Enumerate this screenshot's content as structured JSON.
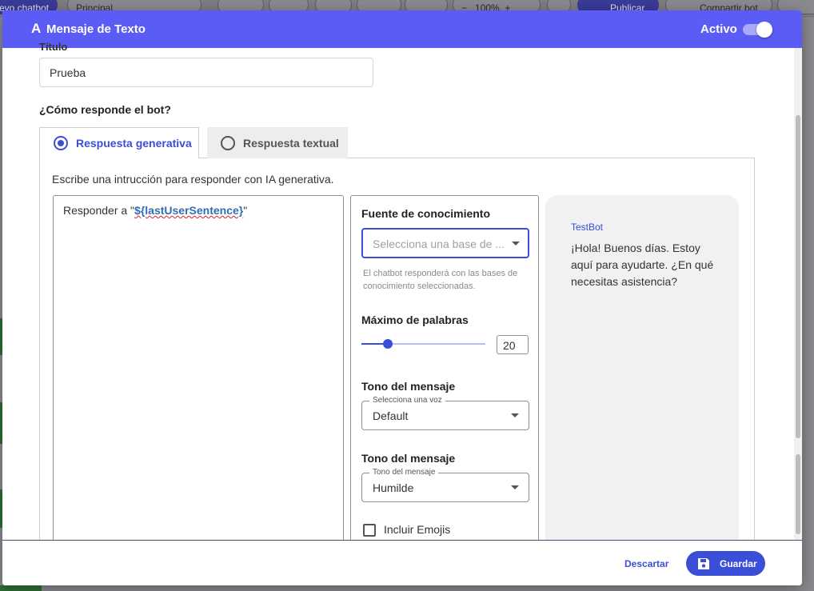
{
  "background_toolbar": {
    "chatbot_tab": "evo chatbot",
    "flow_select": "Principal",
    "zoom": "100%",
    "zoom_minus": "−",
    "zoom_plus": "+",
    "publish_label": "Publicar",
    "share_label": "Compartir bot"
  },
  "modal": {
    "logo_glyph": "A",
    "title": "Mensaje de Texto",
    "active_label": "Activo",
    "active_on": true
  },
  "form": {
    "title_label": "Título",
    "title_value": "Prueba",
    "question": "¿Cómo responde el bot?",
    "tabs": [
      {
        "label": "Respuesta generativa",
        "selected": true
      },
      {
        "label": "Respuesta textual",
        "selected": false
      }
    ],
    "instruction": "Escribe una intrucción para responder con IA generativa.",
    "prompt_prefix": "Responder a \"",
    "prompt_variable": "${lastUserSentence}",
    "prompt_suffix": "\""
  },
  "settings": {
    "knowledge_label": "Fuente de conocimiento",
    "knowledge_placeholder": "Selecciona una base de ...",
    "knowledge_help": "El chatbot responderá con las bases de conocimiento seleccionadas.",
    "max_words_label": "Máximo de palabras",
    "max_words_value": "20",
    "max_words_slider_fraction": 0.21,
    "voice_section_label": "Tono del mensaje",
    "voice_legend": "Selecciona una voz",
    "voice_value": "Default",
    "tone_section_label": "Tono del mensaje",
    "tone_legend": "Tono del mensaje",
    "tone_value": "Humilde",
    "emoji_label": "Incluir Emojis",
    "emoji_checked": false
  },
  "preview": {
    "bot_name": "TestBot",
    "message": "¡Hola! Buenos días. Estoy aquí para ayudarte. ¿En qué necesitas asistencia?"
  },
  "footer": {
    "discard_label": "Descartar",
    "save_label": "Guardar"
  },
  "colors": {
    "header": "#5b5cf6",
    "accent": "#3b4ed8",
    "variable_text": "#2f6fb0"
  }
}
